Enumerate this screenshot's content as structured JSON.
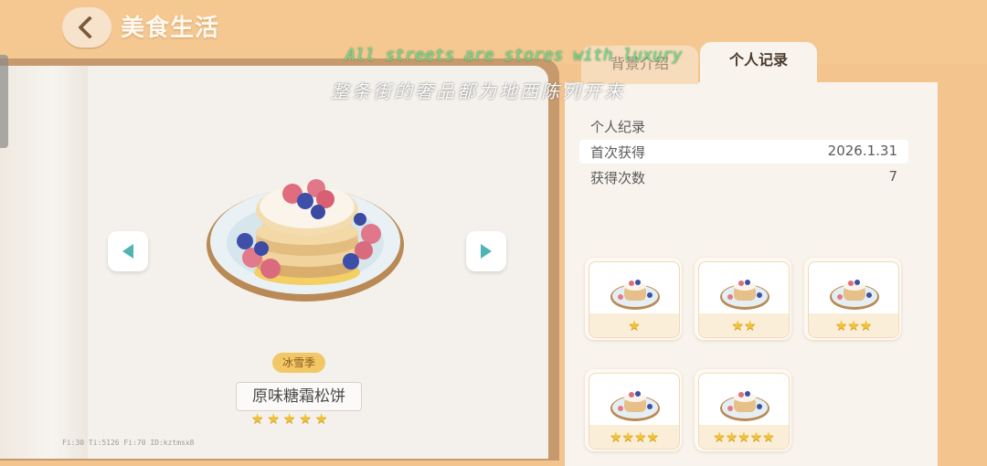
{
  "header": {
    "title": "美食生活"
  },
  "subtitles": {
    "english": "All streets are stores with luxury",
    "chinese": "整条街的奢品都为地西陈列开来"
  },
  "tabs": [
    {
      "label": "背景介绍",
      "active": false
    },
    {
      "label": "个人记录",
      "active": true
    }
  ],
  "dish": {
    "season": "冰雪季",
    "name": "原味糖霜松饼",
    "stars": 5
  },
  "record": {
    "heading": "个人纪录",
    "rows": [
      {
        "label": "首次获得",
        "value": "2026.1.31"
      },
      {
        "label": "获得次数",
        "value": "7"
      }
    ]
  },
  "variants": [
    {
      "stars": 1
    },
    {
      "stars": 2
    },
    {
      "stars": 3
    },
    {
      "stars": 4
    },
    {
      "stars": 5
    }
  ],
  "debug": "Fi:30   Ti:5126   Fi:70   ID:kztmsx8",
  "colors": {
    "accent": "#f5c892",
    "star": "#f2c23a",
    "arrow": "#4fb4b3"
  }
}
